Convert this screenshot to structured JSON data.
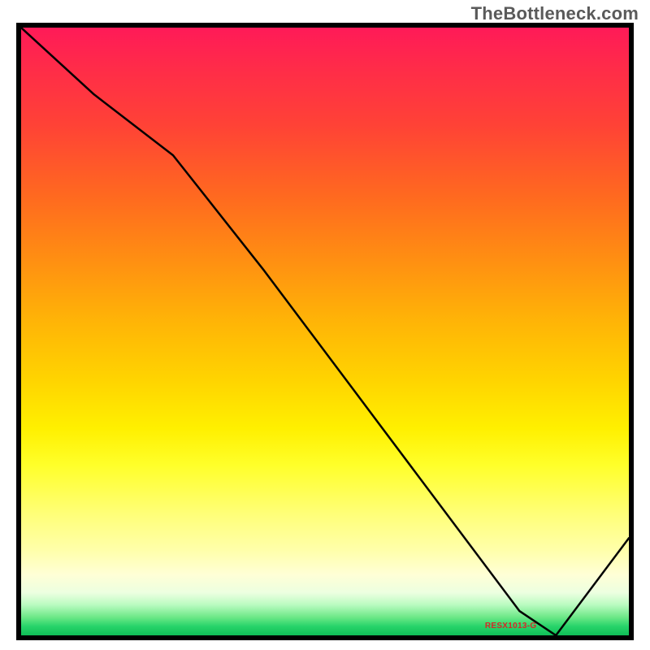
{
  "watermark": "TheBottleneck.com",
  "annotation_label": "RESX1013-G",
  "colors": {
    "frame": "#000000",
    "curve": "#000000",
    "annotation": "#d62728"
  },
  "chart_data": {
    "type": "line",
    "title": "",
    "xlabel": "",
    "ylabel": "",
    "xlim": [
      0,
      100
    ],
    "ylim": [
      0,
      100
    ],
    "grid": false,
    "legend": false,
    "series": [
      {
        "name": "curve",
        "x": [
          0,
          12,
          25,
          40,
          55,
          70,
          82,
          88,
          100
        ],
        "y": [
          100,
          89,
          79,
          60,
          40,
          20,
          4,
          0,
          16
        ]
      }
    ],
    "annotation": {
      "text": "RESX1013-G",
      "x": 83,
      "y": 1
    }
  }
}
